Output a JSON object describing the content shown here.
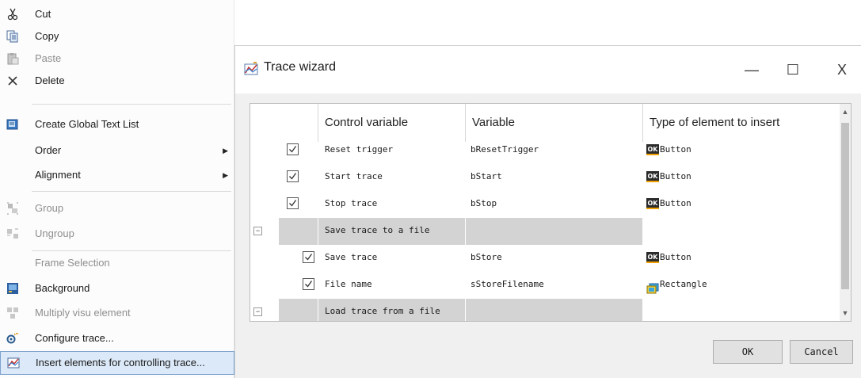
{
  "context_menu": {
    "items": [
      {
        "label": "Cut",
        "icon": "scissors-icon",
        "disabled": false
      },
      {
        "label": "Copy",
        "icon": "copy-icon",
        "disabled": false
      },
      {
        "label": "Paste",
        "icon": "paste-icon",
        "disabled": true
      },
      {
        "label": "Delete",
        "icon": "delete-icon",
        "disabled": false
      },
      {
        "label": "Create Global Text List",
        "icon": "text-list-icon",
        "disabled": false
      },
      {
        "label": "Order",
        "submenu": true,
        "disabled": false
      },
      {
        "label": "Alignment",
        "submenu": true,
        "disabled": false
      },
      {
        "label": "Group",
        "icon": "group-icon",
        "disabled": true
      },
      {
        "label": "Ungroup",
        "icon": "ungroup-icon",
        "disabled": true
      },
      {
        "label": "Frame Selection",
        "disabled": true
      },
      {
        "label": "Background",
        "icon": "background-icon",
        "disabled": false
      },
      {
        "label": "Multiply visu element",
        "icon": "multiply-icon",
        "disabled": true
      },
      {
        "label": "Configure trace...",
        "icon": "configure-trace-icon",
        "disabled": false
      },
      {
        "label": "Insert elements for controlling trace...",
        "icon": "trace-icon",
        "disabled": false,
        "selected": true
      }
    ]
  },
  "dialog": {
    "title": "Trace wizard",
    "window_buttons": {
      "minimize": "—",
      "maximize": "☐",
      "close": "X"
    },
    "grid": {
      "columns": [
        "Control variable",
        "Variable",
        "Type of element to insert"
      ],
      "rows": [
        {
          "kind": "item",
          "checked": true,
          "control": "Reset trigger",
          "variable": "bResetTrigger",
          "element": "Button"
        },
        {
          "kind": "item",
          "checked": true,
          "control": "Start trace",
          "variable": "bStart",
          "element": "Button"
        },
        {
          "kind": "item",
          "checked": true,
          "control": "Stop trace",
          "variable": "bStop",
          "element": "Button"
        },
        {
          "kind": "group",
          "expander": "−",
          "control": "Save trace to a file"
        },
        {
          "kind": "subitem",
          "checked": true,
          "control": "Save trace",
          "variable": "bStore",
          "element": "Button"
        },
        {
          "kind": "subitem",
          "checked": true,
          "control": "File name",
          "variable": "sStoreFilename",
          "element": "Rectangle"
        },
        {
          "kind": "group",
          "expander": "−",
          "control": "Load trace from a file"
        }
      ],
      "ok_badge": "OK"
    },
    "buttons": {
      "ok": "OK",
      "cancel": "Cancel"
    }
  },
  "colors": {
    "selection_bg": "#dce9f8",
    "group_row": "#d3d3d3",
    "dialog_bg": "#f0f0f0"
  }
}
